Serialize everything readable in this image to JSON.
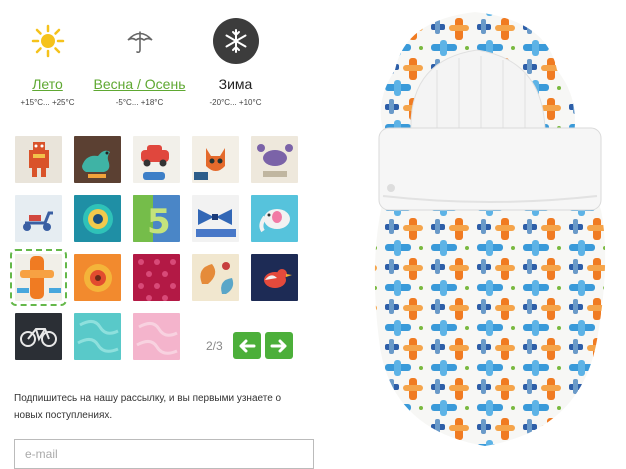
{
  "seasons": [
    {
      "label": "Лето",
      "range": "+15°C... +25°C",
      "icon": "sun-icon",
      "active": false
    },
    {
      "label": "Весна / Осень",
      "range": "-5°C... +18°C",
      "icon": "umbrella-icon",
      "active": false
    },
    {
      "label": "Зима",
      "range": "-20°C... +10°C",
      "icon": "snowflake-icon",
      "active": true
    }
  ],
  "swatches": [
    {
      "name": "swatch-robots",
      "bg": "#e9e4da"
    },
    {
      "name": "swatch-dinosaurs",
      "bg": "#5b4032"
    },
    {
      "name": "swatch-cars",
      "bg": "#f2f0ea"
    },
    {
      "name": "swatch-foxes",
      "bg": "#f3efe6"
    },
    {
      "name": "swatch-crabs",
      "bg": "#eee8dc"
    },
    {
      "name": "swatch-scooters",
      "bg": "#e6edf2"
    },
    {
      "name": "swatch-circles",
      "bg": "#1f8fa5"
    },
    {
      "name": "swatch-numbers",
      "bg": "#4a86c7"
    },
    {
      "name": "swatch-bows",
      "bg": "#f2f2f2"
    },
    {
      "name": "swatch-elephants",
      "bg": "#56c3dc"
    },
    {
      "name": "swatch-planes",
      "bg": "#f1efe8",
      "selected": true
    },
    {
      "name": "swatch-flowers-orange",
      "bg": "#f28a2e"
    },
    {
      "name": "swatch-dots-crimson",
      "bg": "#b31945"
    },
    {
      "name": "swatch-paisley",
      "bg": "#f1e7cf"
    },
    {
      "name": "swatch-birds",
      "bg": "#1d2b55"
    },
    {
      "name": "swatch-bicycles",
      "bg": "#2b2f35"
    },
    {
      "name": "swatch-turquoise",
      "bg": "#59c9c9"
    },
    {
      "name": "swatch-pink",
      "bg": "#f4b4cc"
    }
  ],
  "pager": {
    "text": "2/3"
  },
  "newsletter": {
    "text": "Подпишитесь на нашу рассылку, и вы первыми узнаете о новых поступлениях."
  },
  "email": {
    "placeholder": "e-mail"
  },
  "colors": {
    "accent_green": "#4caf3a",
    "link_green": "#5fa832",
    "dark": "#3c3c3c"
  }
}
